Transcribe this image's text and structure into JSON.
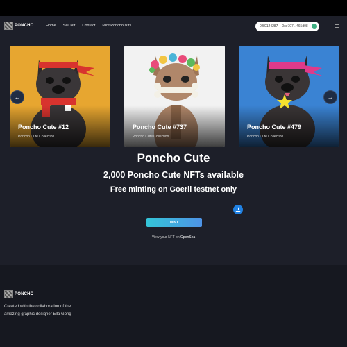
{
  "brand": {
    "name": "PONCHO"
  },
  "nav": {
    "links": [
      "Home",
      "Sell Nft",
      "Contact",
      "Mint Poncho Nfts"
    ]
  },
  "wallet": {
    "balance": "0.50124287",
    "address": "0xe707...465d08"
  },
  "cards": [
    {
      "title": "Poncho Cute #12",
      "collection": "Poncho Cute Collection",
      "bg": "#e7a630"
    },
    {
      "title": "Poncho Cute #737",
      "collection": "Poncho Cute Collection",
      "bg": "#f2f2f2"
    },
    {
      "title": "Poncho Cute #479",
      "collection": "Poncho Cute Collection",
      "bg": "#3a83d3"
    }
  ],
  "carousel": {
    "prev": "←",
    "next": "→"
  },
  "hero": {
    "title": "Poncho Cute",
    "subtitle": "2,000 Poncho Cute NFTs available",
    "tagline": "Free minting on Goerli testnet only"
  },
  "mint": {
    "label": "MINT"
  },
  "view_nft": {
    "prefix": "View your NFT on ",
    "link": "OpenSea"
  },
  "footer": {
    "brand": "PONCHO",
    "description": "Created with the collaboration of the amazing graphic designer Ella Gong"
  },
  "colors": {
    "accent_start": "#34c5d8",
    "accent_end": "#4e93e6",
    "wallet_status": "#3fb083",
    "opensea": "#2081e2"
  }
}
